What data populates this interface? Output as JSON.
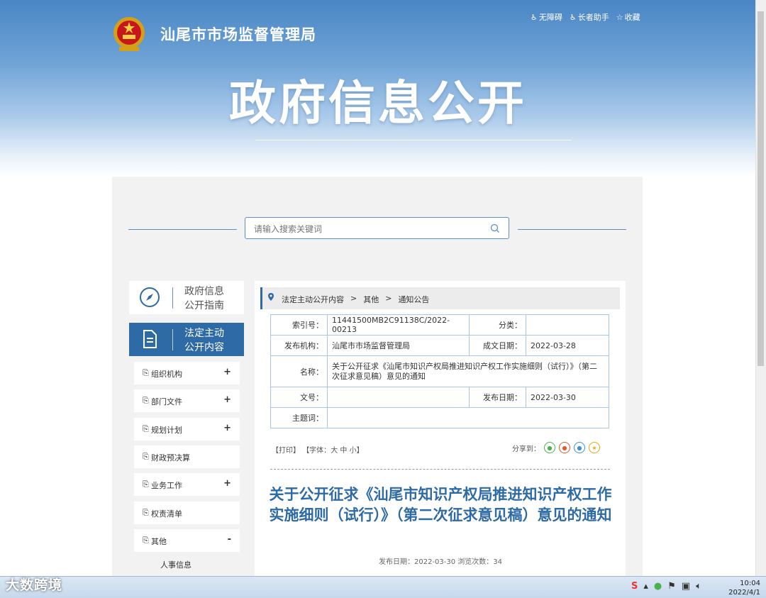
{
  "header": {
    "site_name": "汕尾市市场监督管理局",
    "links": [
      {
        "icon": "accessibility-icon",
        "label": "无障碍"
      },
      {
        "icon": "elder-icon",
        "label": "长者助手"
      },
      {
        "icon": "star-icon",
        "label": "收藏"
      }
    ],
    "hero_title": "政府信息公开"
  },
  "search": {
    "placeholder": "请输入搜索关键词"
  },
  "sidebar": {
    "guide_line1": "政府信息",
    "guide_line2": "公开指南",
    "active_line1": "法定主动",
    "active_line2": "公开内容",
    "items": [
      {
        "label": "组织机构",
        "toggle": "+"
      },
      {
        "label": "部门文件",
        "toggle": "+"
      },
      {
        "label": "规划计划",
        "toggle": "+"
      },
      {
        "label": "财政预决算",
        "toggle": ""
      },
      {
        "label": "业务工作",
        "toggle": "+"
      },
      {
        "label": "权责清单",
        "toggle": ""
      },
      {
        "label": "其他",
        "toggle": "-"
      }
    ],
    "sub_item": "人事信息"
  },
  "breadcrumb": [
    "法定主动公开内容",
    ">",
    "其他",
    ">",
    "通知公告"
  ],
  "meta": {
    "index_label": "索引号：",
    "index_value": "11441500MB2C91138C/2022-00213",
    "category_label": "分类：",
    "category_value": "",
    "publisher_label": "发布机构：",
    "publisher_value": "汕尾市市场监督管理局",
    "created_label": "成文日期：",
    "created_value": "2022-03-28",
    "name_label": "名称：",
    "name_value": "关于公开征求《汕尾市知识产权局推进知识产权工作实施细则（试行）》（第二次征求意见稿）意见的通知",
    "docno_label": "文号：",
    "docno_value": "",
    "pubdate_label": "发布日期：",
    "pubdate_value": "2022-03-30",
    "subject_label": "主题词：",
    "subject_value": ""
  },
  "tools": {
    "print": "【打印】",
    "font_prefix": "【字体：",
    "font_large": "大",
    "font_medium": "中",
    "font_small": "小",
    "font_suffix": "】",
    "share_label": "分享到："
  },
  "article": {
    "title": "关于公开征求《汕尾市知识产权局推进知识产权工作实施细则（试行）》（第二次征求意见稿）意见的通知",
    "meta": "发布日期：2022-03-30  浏览次数：34"
  },
  "taskbar": {
    "time": "10:04",
    "date": "2022/4/1"
  },
  "watermark": "大数跨境",
  "colors": {
    "primary": "#2e6aa5",
    "border": "#aac6e4"
  }
}
